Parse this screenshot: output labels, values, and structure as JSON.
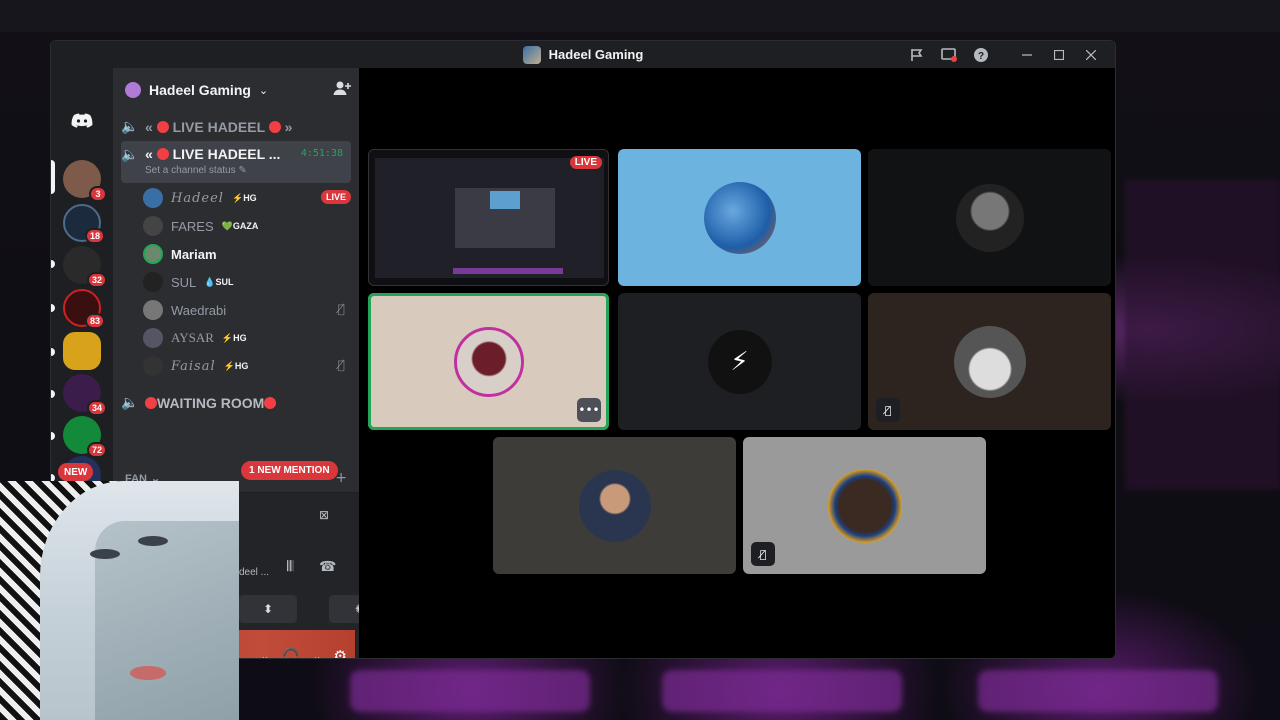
{
  "window": {
    "title": "Hadeel Gaming",
    "controls": [
      "flag-icon",
      "screen-share-icon",
      "help-icon",
      "minimize-icon",
      "maximize-icon",
      "close-icon"
    ]
  },
  "rail": {
    "servers": [
      {
        "name": "server-1",
        "badge": "3",
        "color": "#7d5a4a"
      },
      {
        "name": "server-sai",
        "badge": "18",
        "color": "#1b2b3d"
      },
      {
        "name": "server-logo",
        "badge": "32",
        "color": "#2a2a2a"
      },
      {
        "name": "server-sts",
        "badge": "83",
        "color": "#3a0f0f"
      },
      {
        "name": "server-gold",
        "badge": "",
        "color": "#d9a21b"
      },
      {
        "name": "server-arabic",
        "badge": "34",
        "color": "#3b1c4a"
      },
      {
        "name": "server-sul",
        "badge": "72",
        "color": "#138a3a"
      },
      {
        "name": "server-new",
        "badge": "NEW",
        "color": "#22305c"
      }
    ]
  },
  "sidebar": {
    "guild_name": "Hadeel Gaming",
    "channels": [
      {
        "label": "LIVE HADEEL"
      },
      {
        "label": "LIVE HADEEL ...",
        "timer": "4:51:38",
        "status_hint": "Set a channel status"
      },
      {
        "label": "WAITING ROOM"
      }
    ],
    "members": [
      {
        "name": "Hadeel",
        "tag": "HG",
        "badge": "LIVE",
        "color": "#3a6fa6"
      },
      {
        "name": "FARES",
        "tag": "GAZA",
        "color": "#444"
      },
      {
        "name": "Mariam",
        "tag": "",
        "color": "#6a8a6a"
      },
      {
        "name": "SUL",
        "tag": "SUL",
        "color": "#222"
      },
      {
        "name": "Waedrabi",
        "tag": "",
        "color": "#777"
      },
      {
        "name": "AYSAR",
        "tag": "HG",
        "color": "#556"
      },
      {
        "name": "Faisal",
        "tag": "HG",
        "color": "#333"
      }
    ],
    "category": "FAN",
    "mention_pill": "1 NEW MENTION",
    "voice_panel": {
      "name": "deel ..."
    }
  },
  "stage": {
    "tiles": [
      {
        "label": "stream-preview",
        "bg": "#101014",
        "live": "LIVE"
      },
      {
        "label": "tile-art",
        "bg": "#6cb3e0"
      },
      {
        "label": "tile-portrait-bw",
        "bg": "#111214"
      },
      {
        "label": "tile-hadeel",
        "bg": "#d8cabc",
        "speaking": true
      },
      {
        "label": "tile-logo",
        "bg": "#1e1f22"
      },
      {
        "label": "tile-car",
        "bg": "#2d2420",
        "muted": true
      },
      {
        "label": "tile-man",
        "bg": "#3d3c38"
      },
      {
        "label": "tile-glow",
        "bg": "#9a9a9a",
        "muted": true
      }
    ]
  }
}
